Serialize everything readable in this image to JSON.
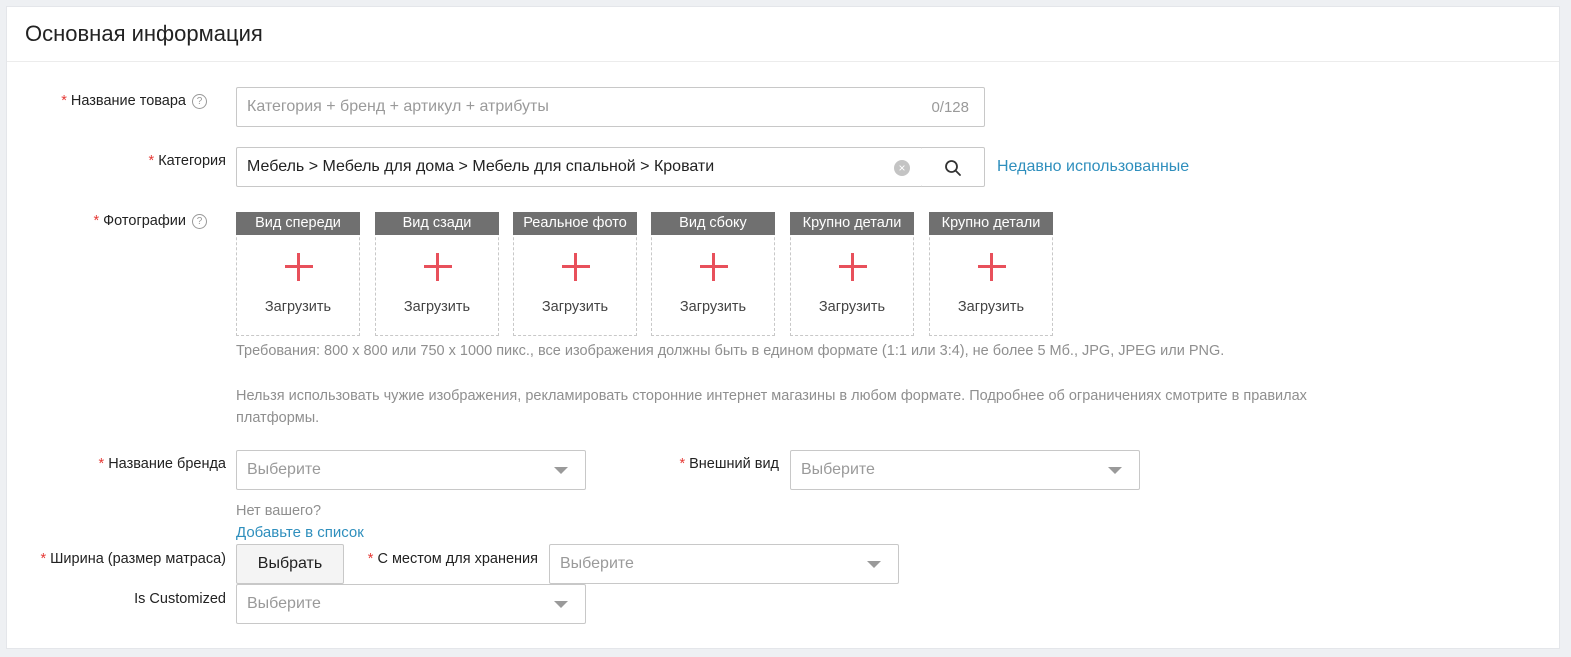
{
  "section": {
    "title": "Основная информация"
  },
  "product_name": {
    "label": "Название товара",
    "placeholder": "Категория + бренд + артикул + атрибуты",
    "counter": "0/128",
    "help_icon": "question-circle-icon"
  },
  "category": {
    "label": "Категория",
    "value": "Мебель > Мебель для дома > Мебель для спальной > Кровати",
    "clear_icon": "clear-icon",
    "search_icon": "search-icon",
    "recent_link": "Недавно использованные"
  },
  "photos": {
    "label": "Фотографии",
    "help_icon": "question-circle-icon",
    "slots": [
      {
        "title": "Вид спереди",
        "upload": "Загрузить"
      },
      {
        "title": "Вид сзади",
        "upload": "Загрузить"
      },
      {
        "title": "Реальное фото",
        "upload": "Загрузить"
      },
      {
        "title": "Вид сбоку",
        "upload": "Загрузить"
      },
      {
        "title": "Крупно детали",
        "upload": "Загрузить"
      },
      {
        "title": "Крупно детали",
        "upload": "Загрузить"
      }
    ],
    "requirements": "Требования: 800 x 800 или 750 x 1000 пикс., все изображения должны быть в едином формате (1:1 или 3:4), не более 5 Мб., JPG, JPEG или PNG.",
    "restrictions": "Нельзя использовать чужие изображения, рекламировать сторонние интернет магазины в любом формате. Подробнее об ограничениях смотрите в правилах платформы."
  },
  "brand": {
    "label": "Название бренда",
    "placeholder": "Выберите",
    "missing_text": "Нет вашего?",
    "add_link": "Добавьте в список"
  },
  "appearance": {
    "label": "Внешний вид",
    "placeholder": "Выберите"
  },
  "width": {
    "label": "Ширина (размер матраса)",
    "button": "Выбрать"
  },
  "storage": {
    "label": "С местом для хранения",
    "placeholder": "Выберите"
  },
  "customized": {
    "label": "Is Customized",
    "placeholder": "Выберите"
  },
  "colors": {
    "required": "#e53935",
    "link": "#2f8fbd",
    "plus": "#e8505b",
    "slot_header": "#707070"
  }
}
